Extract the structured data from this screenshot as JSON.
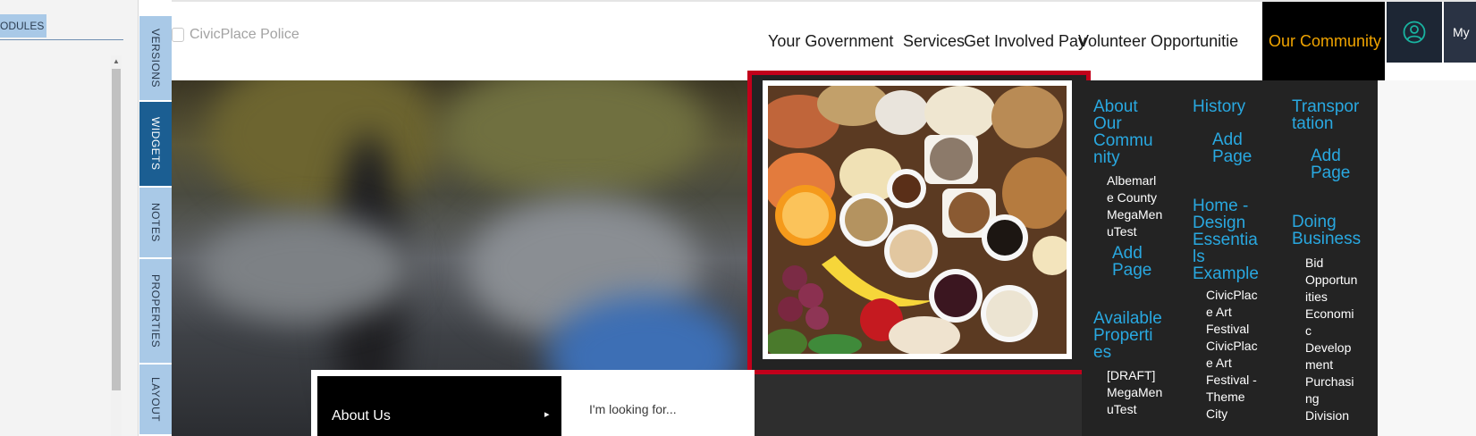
{
  "modules_panel": {
    "tab_label": "ODULES"
  },
  "vertical_tabs": [
    {
      "label": "VERSIONS"
    },
    {
      "label": "WIDGETS",
      "active": true
    },
    {
      "label": "NOTES"
    },
    {
      "label": "PROPERTIES"
    },
    {
      "label": "LAYOUT"
    }
  ],
  "header": {
    "logo_text": "CivicPlace Police",
    "nav": [
      "Your Government",
      "Services",
      "Get Involved",
      "Pay",
      "Volunteer Opportunitie",
      "Our Community"
    ],
    "user_icon": "user-circle-icon",
    "my_label": "My"
  },
  "megamenu": {
    "image_alt": "food-assortment-image",
    "col1": {
      "heading": [
        "About",
        "Our",
        "Commu",
        "nity"
      ],
      "items": [
        "Albemarl",
        "e County",
        "MegaMen",
        "uTest"
      ],
      "add_page": [
        "Add",
        "Page"
      ],
      "heading2": [
        "Available",
        "Properti",
        "es"
      ],
      "items2": [
        "[DRAFT]",
        "MegaMen",
        "uTest"
      ]
    },
    "col2": {
      "heading": [
        "History"
      ],
      "add_page": [
        "Add",
        "Page"
      ],
      "heading2": [
        "Home -",
        "Design",
        "Essentia",
        "ls",
        "Example"
      ],
      "items2": [
        "CivicPlac",
        "e Art",
        "Festival",
        "CivicPlac",
        "e Art",
        "Festival -",
        "Theme",
        "City"
      ]
    },
    "col3": {
      "heading": [
        "Transpor",
        "tation"
      ],
      "add_page": [
        "Add",
        "Page"
      ],
      "heading2": [
        "Doing",
        "Business"
      ],
      "items2": [
        "Bid",
        "Opportun",
        "ities",
        "Economi",
        "c",
        "Develop",
        "ment",
        "Purchasi",
        "ng",
        "Division"
      ]
    }
  },
  "bottom": {
    "about_label": "About Us",
    "about_arrow": "▸",
    "search_placeholder": "I'm looking for..."
  },
  "colors": {
    "accent_blue": "#29a8e0",
    "community_orange": "#f0a400",
    "highlight_red": "#c2001b",
    "tab_blue": "#a9c9e7",
    "tab_active": "#1b5e92"
  }
}
